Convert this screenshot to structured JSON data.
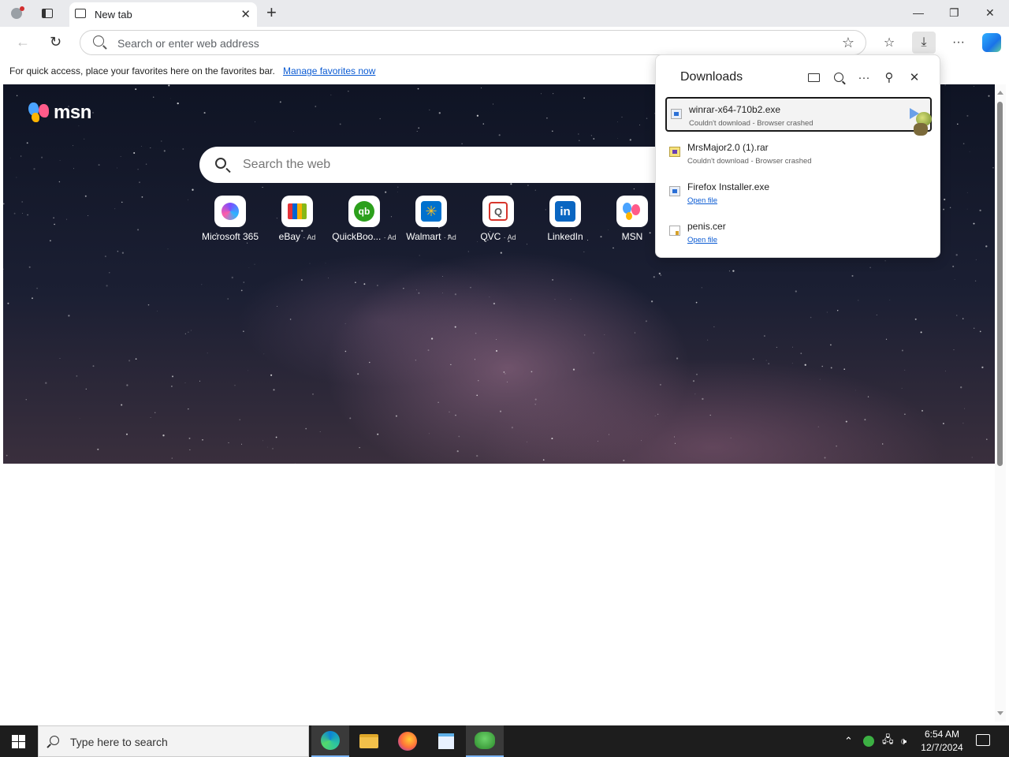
{
  "browser": {
    "tab_title": "New tab",
    "address_placeholder": "Search or enter web address"
  },
  "favorites_bar": {
    "message": "For quick access, place your favorites here on the favorites bar.",
    "link": "Manage favorites now"
  },
  "msn": {
    "logo_text": "msn",
    "search_placeholder": "Search the web",
    "tiles": [
      {
        "label": "Microsoft 365",
        "ad": "",
        "icon": "microsoft365-icon"
      },
      {
        "label": "eBay",
        "ad": "· Ad",
        "icon": "ebay-icon"
      },
      {
        "label": "QuickBoo...",
        "ad": "· Ad",
        "icon": "quickbooks-icon"
      },
      {
        "label": "Walmart",
        "ad": "· Ad",
        "icon": "walmart-icon"
      },
      {
        "label": "QVC",
        "ad": "· Ad",
        "icon": "qvc-icon"
      },
      {
        "label": "LinkedIn",
        "ad": "",
        "icon": "linkedin-icon"
      },
      {
        "label": "MSN",
        "ad": "",
        "icon": "msn-icon"
      }
    ]
  },
  "downloads": {
    "title": "Downloads",
    "items": [
      {
        "name": "winrar-x64-710b2.exe",
        "status": "Couldn't download - Browser crashed",
        "icon": "exe-file-icon"
      },
      {
        "name": "MrsMajor2.0 (1).rar",
        "status": "Couldn't download - Browser crashed",
        "icon": "rar-file-icon"
      },
      {
        "name": "Firefox Installer.exe",
        "status": "Open file",
        "icon": "exe-file-icon"
      },
      {
        "name": "penis.cer",
        "status": "Open file",
        "icon": "certificate-file-icon"
      }
    ]
  },
  "taskbar": {
    "search_placeholder": "Type here to search",
    "time": "6:54 AM",
    "date": "12/7/2024"
  }
}
